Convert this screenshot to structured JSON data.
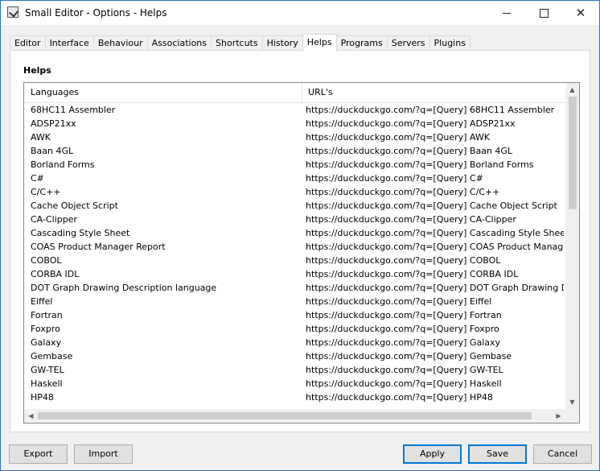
{
  "window": {
    "title": "Small Editor - Options - Helps"
  },
  "tabs": [
    {
      "label": "Editor"
    },
    {
      "label": "Interface"
    },
    {
      "label": "Behaviour"
    },
    {
      "label": "Associations"
    },
    {
      "label": "Shortcuts"
    },
    {
      "label": "History"
    },
    {
      "label": "Helps",
      "active": true
    },
    {
      "label": "Programs"
    },
    {
      "label": "Servers"
    },
    {
      "label": "Plugins"
    }
  ],
  "helps": {
    "section_title": "Helps",
    "columns": {
      "languages": "Languages",
      "urls": "URL's"
    },
    "rows": [
      {
        "language": "68HC11 Assembler",
        "url": "https://duckduckgo.com/?q=[Query] 68HC11 Assembler"
      },
      {
        "language": "ADSP21xx",
        "url": "https://duckduckgo.com/?q=[Query] ADSP21xx"
      },
      {
        "language": "AWK",
        "url": "https://duckduckgo.com/?q=[Query] AWK"
      },
      {
        "language": "Baan 4GL",
        "url": "https://duckduckgo.com/?q=[Query] Baan 4GL"
      },
      {
        "language": "Borland Forms",
        "url": "https://duckduckgo.com/?q=[Query] Borland Forms"
      },
      {
        "language": "C#",
        "url": "https://duckduckgo.com/?q=[Query] C#"
      },
      {
        "language": "C/C++",
        "url": "https://duckduckgo.com/?q=[Query] C/C++"
      },
      {
        "language": "Cache Object Script",
        "url": "https://duckduckgo.com/?q=[Query] Cache Object Script"
      },
      {
        "language": "CA-Clipper",
        "url": "https://duckduckgo.com/?q=[Query] CA-Clipper"
      },
      {
        "language": "Cascading Style Sheet",
        "url": "https://duckduckgo.com/?q=[Query] Cascading Style Sheet"
      },
      {
        "language": "COAS Product Manager Report",
        "url": "https://duckduckgo.com/?q=[Query] COAS Product Manager Repo"
      },
      {
        "language": "COBOL",
        "url": "https://duckduckgo.com/?q=[Query] COBOL"
      },
      {
        "language": "CORBA IDL",
        "url": "https://duckduckgo.com/?q=[Query] CORBA IDL"
      },
      {
        "language": "DOT Graph Drawing Description language",
        "url": "https://duckduckgo.com/?q=[Query] DOT Graph Drawing Descript."
      },
      {
        "language": "Eiffel",
        "url": "https://duckduckgo.com/?q=[Query] Eiffel"
      },
      {
        "language": "Fortran",
        "url": "https://duckduckgo.com/?q=[Query] Fortran"
      },
      {
        "language": "Foxpro",
        "url": "https://duckduckgo.com/?q=[Query] Foxpro"
      },
      {
        "language": "Galaxy",
        "url": "https://duckduckgo.com/?q=[Query] Galaxy"
      },
      {
        "language": "Gembase",
        "url": "https://duckduckgo.com/?q=[Query] Gembase"
      },
      {
        "language": "GW-TEL",
        "url": "https://duckduckgo.com/?q=[Query] GW-TEL"
      },
      {
        "language": "Haskell",
        "url": "https://duckduckgo.com/?q=[Query] Haskell"
      },
      {
        "language": "HP48",
        "url": "https://duckduckgo.com/?q=[Query] HP48"
      }
    ]
  },
  "buttons": {
    "export": "Export",
    "import": "Import",
    "apply": "Apply",
    "save": "Save",
    "cancel": "Cancel"
  },
  "icons": {
    "app": "app-check-icon",
    "minimize": "minimize-icon",
    "maximize": "maximize-icon",
    "close": "close-icon"
  },
  "colors": {
    "window_border": "#2b73c9",
    "primary_button_border": "#0078d7"
  }
}
